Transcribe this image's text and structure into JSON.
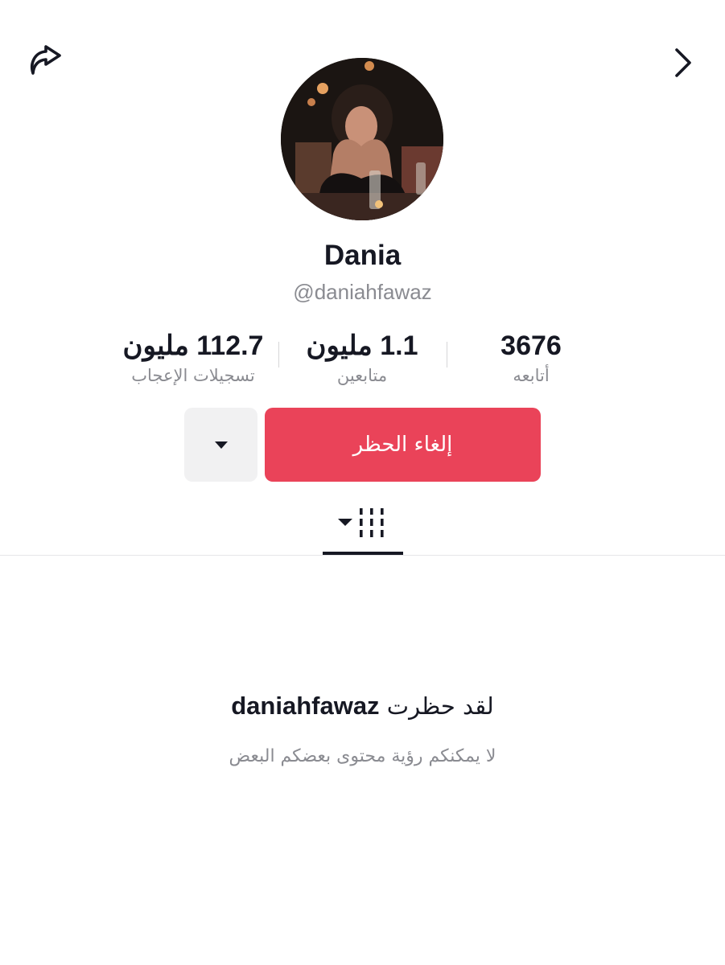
{
  "header": {
    "share_icon": "share-arrow-icon",
    "forward_icon": "chevron-right-icon"
  },
  "profile": {
    "display_name": "Dania",
    "username": "@daniahfawaz"
  },
  "stats": {
    "likes": {
      "value": "112.7 مليون",
      "label": "تسجيلات الإعجاب"
    },
    "followers": {
      "value": "1.1 مليون",
      "label": "متابعين"
    },
    "following": {
      "value": "3676",
      "label": "أتابعه"
    }
  },
  "actions": {
    "unblock_label": "إلغاء الحظر",
    "more_icon": "caret-down-icon"
  },
  "tabs": {
    "videos_icon": "video-grid-icon"
  },
  "blocked_notice": {
    "prefix": "لقد حظرت",
    "username": "daniahfawaz",
    "subtitle": "لا يمكنكم رؤية محتوى بعضكم البعض"
  },
  "colors": {
    "accent": "#ea4359",
    "text_primary": "#161823",
    "text_secondary": "#8a8b91"
  }
}
